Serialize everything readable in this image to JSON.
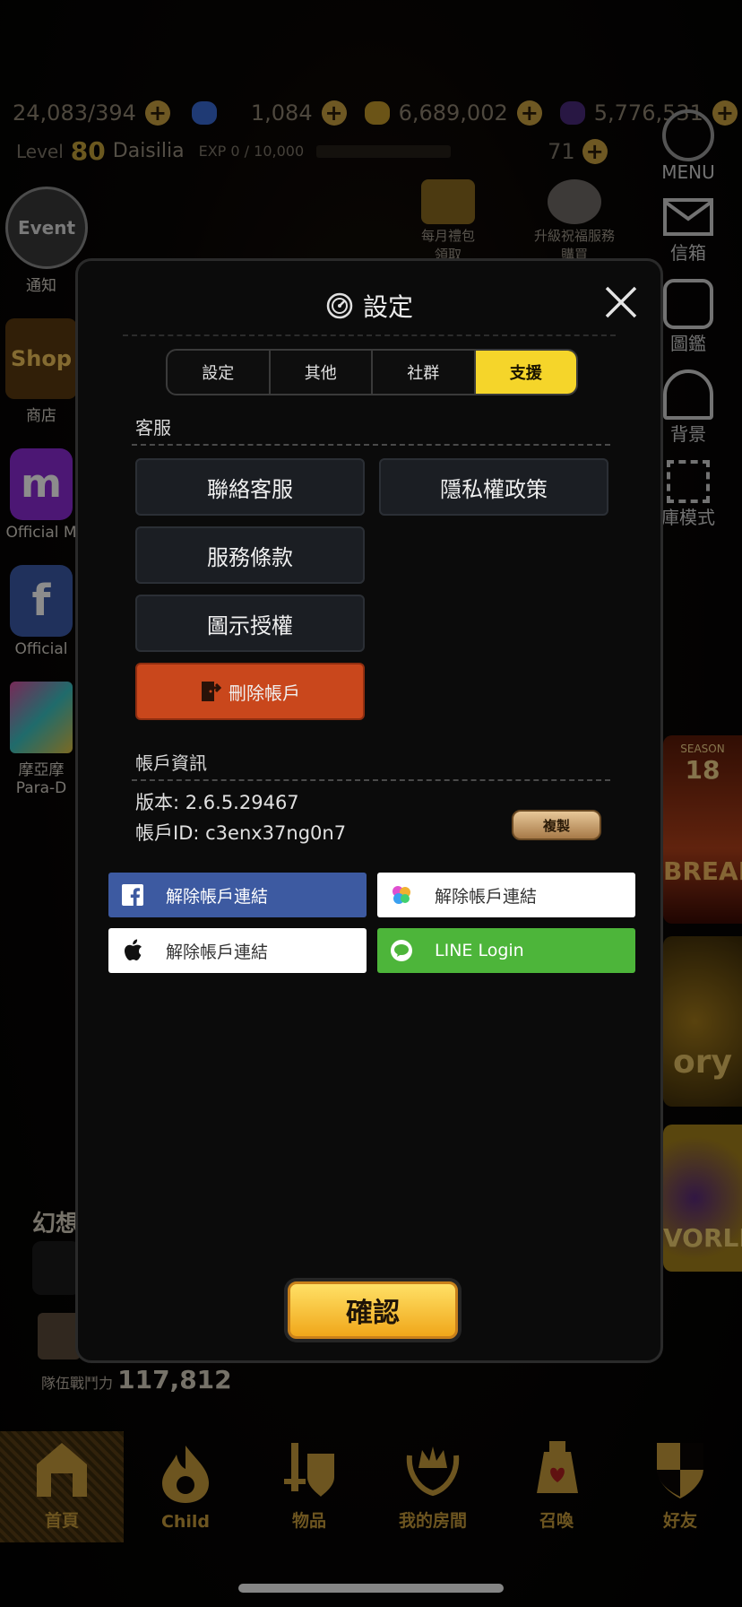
{
  "hud": {
    "stamina": "24,083/394",
    "gems": "1,084",
    "gold": "6,689,002",
    "dark_currency": "5,776,531",
    "level_prefix": "Level",
    "level": "80",
    "player_name": "Daisilia",
    "exp": "EXP 0 / 10,000",
    "energy": "71",
    "plus_glyph": "+"
  },
  "right_menu": {
    "menu": "MENU",
    "mail": "信箱",
    "codex": "圖鑑",
    "background": "背景",
    "garage_mode": "庫模式"
  },
  "left_menu": {
    "event_badge": "Event",
    "notice": "通知",
    "shop_badge": "Shop",
    "shop": "商店",
    "official_m_badge": "m",
    "official_m": "Official M",
    "official_f_badge": "f",
    "official_f": "Official",
    "para_line1": "摩亞摩",
    "para_line2": "Para-D"
  },
  "top_center": {
    "monthly_line1": "每月禮包",
    "monthly_line2": "領取",
    "upgrade_line1": "升級祝福服務",
    "upgrade_line2": "購買"
  },
  "banners": {
    "season_label": "SEASON",
    "season_num": "18",
    "break_text": "BREAK",
    "story_text": "ory",
    "world_text": "VORLD"
  },
  "lower_left": {
    "fantasy_label": "幻想",
    "team_power_label": "隊伍戰鬥力",
    "team_power": "117,812"
  },
  "bottom_nav": [
    {
      "label": "首頁",
      "icon": "home-icon"
    },
    {
      "label": "Child",
      "icon": "child-flame-icon"
    },
    {
      "label": "物品",
      "icon": "item-sword-shield-icon"
    },
    {
      "label": "我的房間",
      "icon": "crown-laurel-icon"
    },
    {
      "label": "召喚",
      "icon": "summon-potion-icon"
    },
    {
      "label": "好友",
      "icon": "friend-shield-icon"
    }
  ],
  "modal": {
    "title": "設定",
    "tabs": [
      "設定",
      "其他",
      "社群",
      "支援"
    ],
    "active_tab": 3,
    "support_section": "客服",
    "contact_support": "聯絡客服",
    "privacy_policy": "隱私權政策",
    "terms_of_service": "服務條款",
    "icon_license": "圖示授權",
    "delete_account": "刪除帳戶",
    "account_section": "帳戶資訊",
    "version": "版本: 2.6.5.29467",
    "account_id": "帳戶ID: c3enx37ng0n7",
    "copy": "複製",
    "fb_unlink": "解除帳戶連結",
    "gamecenter_unlink": "解除帳戶連結",
    "apple_unlink": "解除帳戶連結",
    "line_login": "LINE Login",
    "confirm": "確認"
  },
  "colors": {
    "accent_yellow": "#f5d52a",
    "danger": "#c9471c",
    "facebook": "#3d5aa1",
    "line_green": "#4db53a"
  }
}
